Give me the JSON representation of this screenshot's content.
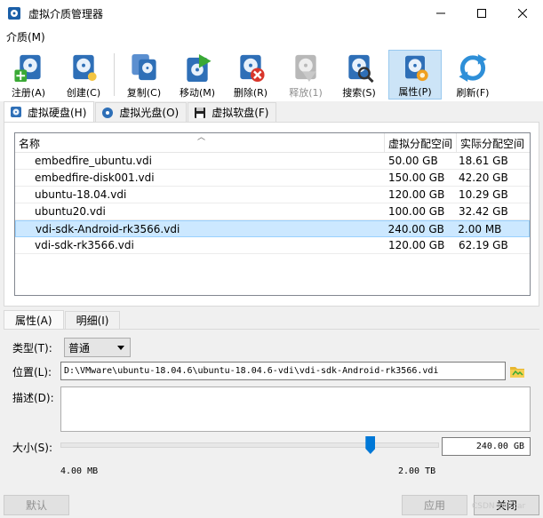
{
  "window": {
    "title": "虚拟介质管理器",
    "minimize_icon": "minimize-icon",
    "maximize_icon": "maximize-icon",
    "close_icon": "close-icon"
  },
  "menu": [
    {
      "label": "介质(M)"
    }
  ],
  "toolbar": {
    "buttons": [
      {
        "label": "注册(A)",
        "icon": "register-disk-icon",
        "state": "normal"
      },
      {
        "label": "创建(C)",
        "icon": "create-disk-icon",
        "state": "normal"
      },
      {
        "label": "复制(C)",
        "icon": "copy-disk-icon",
        "state": "normal"
      },
      {
        "label": "移动(M)",
        "icon": "move-disk-icon",
        "state": "normal"
      },
      {
        "label": "删除(R)",
        "icon": "delete-disk-icon",
        "state": "normal"
      },
      {
        "label": "释放(1)",
        "icon": "release-disk-icon",
        "state": "disabled"
      },
      {
        "label": "搜索(S)",
        "icon": "search-disk-icon",
        "state": "normal"
      },
      {
        "label": "属性(P)",
        "icon": "properties-disk-icon",
        "state": "active"
      },
      {
        "label": "刷新(F)",
        "icon": "refresh-icon",
        "state": "normal"
      }
    ]
  },
  "media_tabs": [
    {
      "label": "虚拟硬盘(H)",
      "icon": "hard-disk-icon",
      "active": true
    },
    {
      "label": "虚拟光盘(O)",
      "icon": "optical-disc-icon",
      "active": false
    },
    {
      "label": "虚拟软盘(F)",
      "icon": "floppy-disk-icon",
      "active": false
    }
  ],
  "table": {
    "columns": [
      "名称",
      "虚拟分配空间",
      "实际分配空间"
    ],
    "rows": [
      {
        "name": "embedfire_ubuntu.vdi",
        "virtual": "50.00 GB",
        "actual": "18.61 GB",
        "selected": false
      },
      {
        "name": "embedfire-disk001.vdi",
        "virtual": "150.00 GB",
        "actual": "42.20 GB",
        "selected": false
      },
      {
        "name": "ubuntu-18.04.vdi",
        "virtual": "120.00 GB",
        "actual": "10.29 GB",
        "selected": false
      },
      {
        "name": "ubuntu20.vdi",
        "virtual": "100.00 GB",
        "actual": "32.42 GB",
        "selected": false
      },
      {
        "name": "vdi-sdk-Android-rk3566.vdi",
        "virtual": "240.00 GB",
        "actual": "2.00 MB",
        "selected": true
      },
      {
        "name": "vdi-sdk-rk3566.vdi",
        "virtual": "120.00 GB",
        "actual": "62.19 GB",
        "selected": false
      }
    ]
  },
  "detail_tabs": [
    {
      "label": "属性(A)",
      "active": true
    },
    {
      "label": "明细(I)",
      "active": false
    }
  ],
  "properties": {
    "type_label": "类型(T):",
    "type_value": "普通",
    "location_label": "位置(L):",
    "location_value": "D:\\VMware\\ubuntu-18.04.6\\ubuntu-18.04.6-vdi\\vdi-sdk-Android-rk3566.vdi",
    "description_label": "描述(D):",
    "description_value": "",
    "size_label": "大小(S):",
    "size_value": "240.00 GB",
    "size_min_label": "4.00 MB",
    "size_max_label": "2.00 TB",
    "size_slider_fraction": 0.82
  },
  "buttons": {
    "reset": "默认",
    "apply": "应用",
    "close": "关闭"
  },
  "watermark": "CSDN @lircar"
}
